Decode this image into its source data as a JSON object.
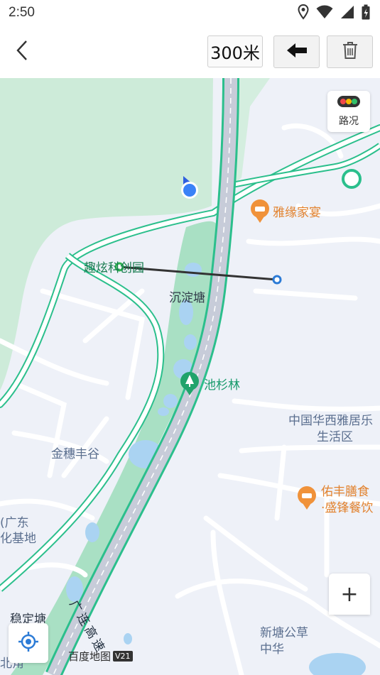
{
  "status_bar": {
    "time": "2:50",
    "icons": [
      "location-icon",
      "wifi-icon",
      "signal-icon",
      "battery-icon"
    ]
  },
  "toolbar": {
    "back_icon": "chevron-left-icon",
    "distance_label": "300米",
    "undo_icon": "arrow-left-icon",
    "delete_icon": "trash-icon"
  },
  "map": {
    "traffic_label": "路况",
    "zoom_in_label": "+",
    "locate_icon": "crosshair-icon",
    "labels": {
      "quxuan": "趣炫科创园",
      "chendiantang": "沉淀塘",
      "chishanlin": "池杉林",
      "yayuan": "雅缘家宴",
      "zhongguo_huaxi": "中国华西雅居乐",
      "shenghuoqu": "生活区",
      "jinsuifenggu": "金穗丰谷",
      "youfeng": "佑丰膳食",
      "shengfeng": "·盛锋餐饮",
      "guangdong": "(广东",
      "jidi": "化基地",
      "wendingtang": "稳定塘",
      "beijiao": "北角",
      "guanglian": "广连高速",
      "xintang": "新塘公草",
      "zhonghua": "中华"
    },
    "logo_text": "百度地图",
    "logo_version": "V21",
    "colors": {
      "green_area": "#cdebd9",
      "park_fill": "#a9e0c4",
      "road_outline": "#2bbf8c",
      "highway_fill": "#c7ccd9",
      "measure_line": "#333333",
      "point_green": "#2fb24f",
      "point_blue": "#2c7bd6",
      "user_dot": "#3a82f7",
      "water": "#aad3f2"
    }
  }
}
